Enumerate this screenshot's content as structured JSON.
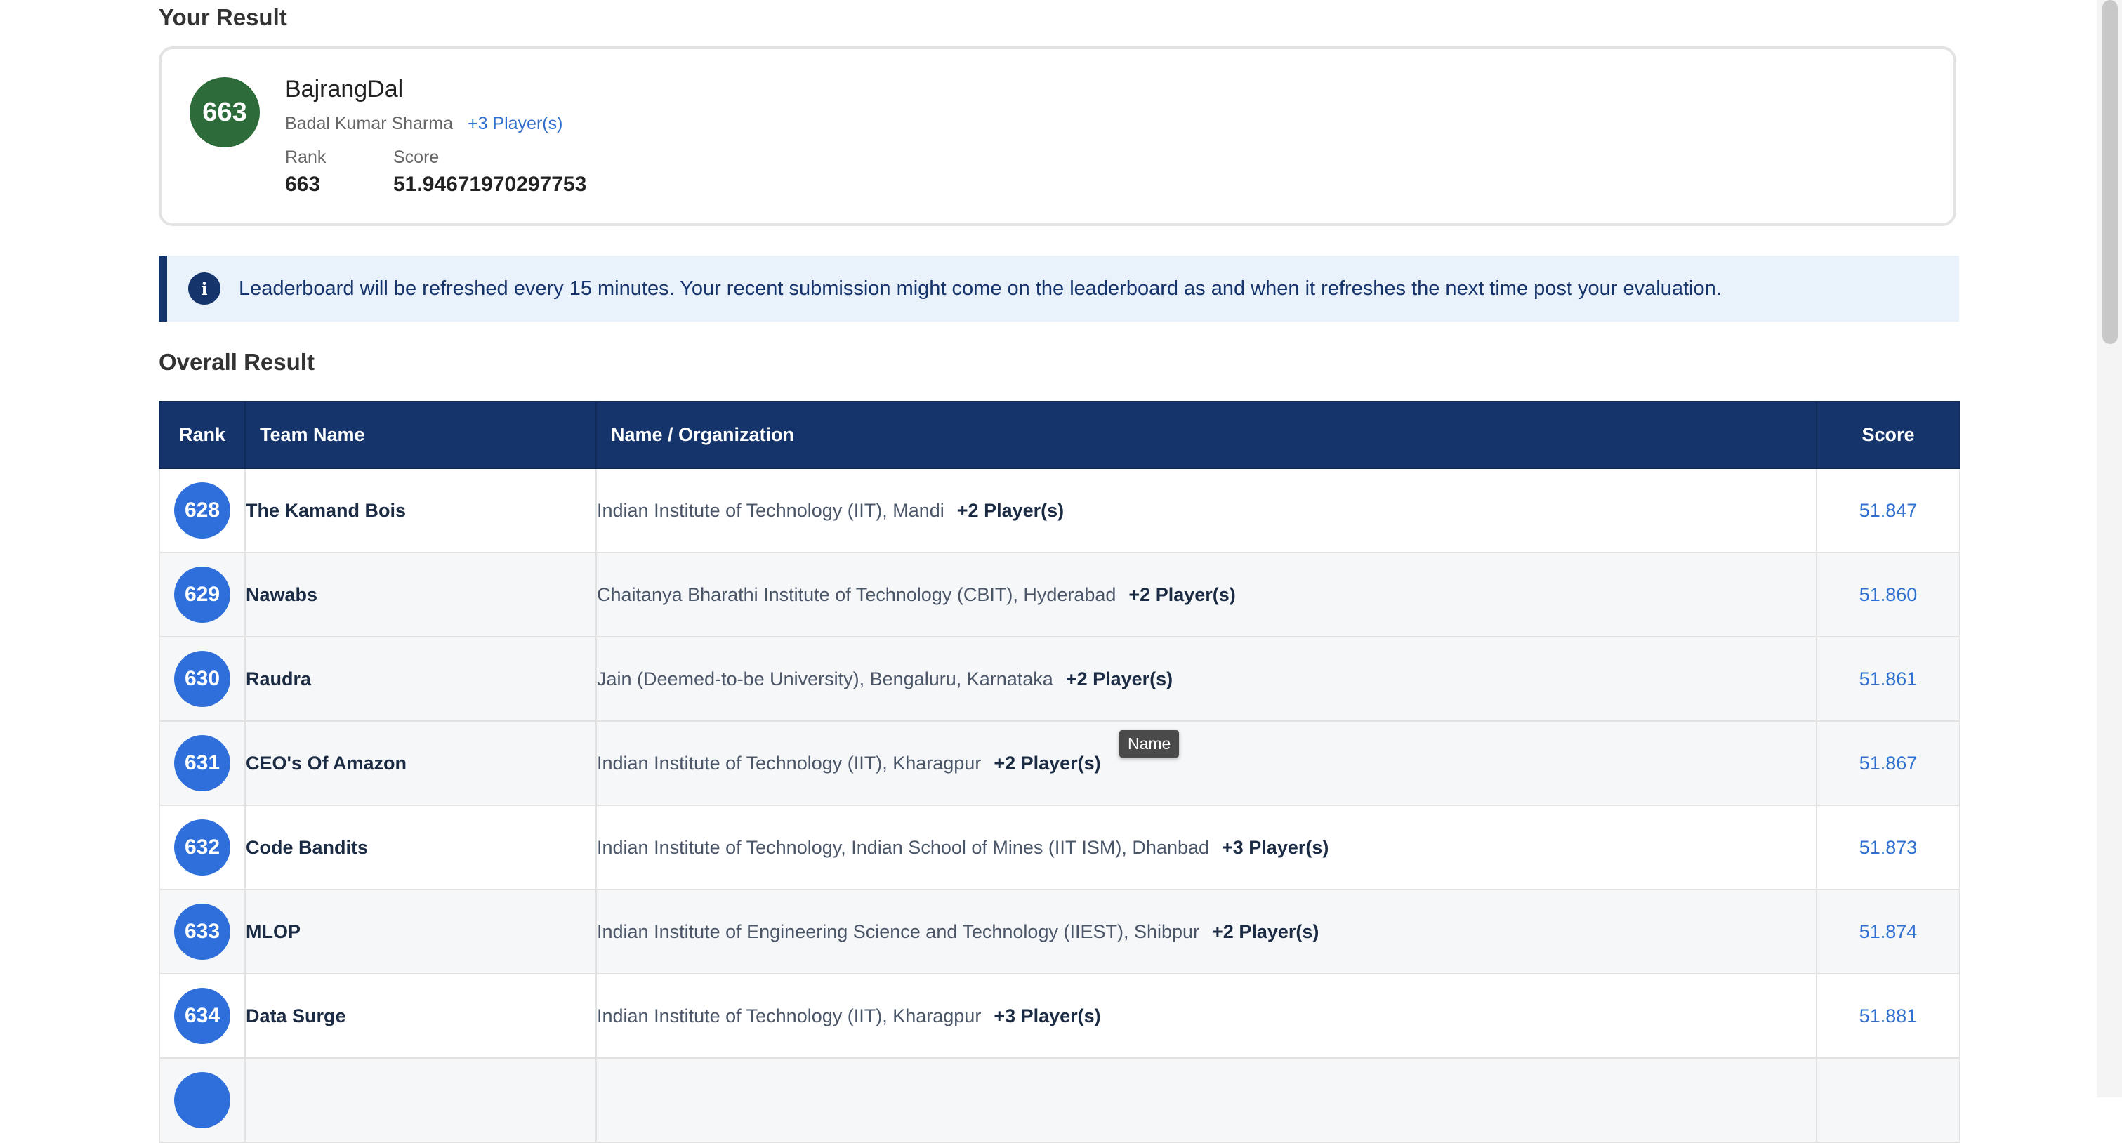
{
  "your_result": {
    "section_title": "Your Result",
    "rank_badge": "663",
    "team_name": "BajrangDal",
    "member": "Badal Kumar Sharma",
    "more_players": "+3 Player(s)",
    "rank_label": "Rank",
    "rank_value": "663",
    "score_label": "Score",
    "score_value": "51.94671970297753"
  },
  "info_banner": {
    "icon": "info-icon",
    "text": "Leaderboard will be refreshed every 15 minutes. Your recent submission might come on the leaderboard as and when it refreshes the next time post your evaluation."
  },
  "overall": {
    "section_title": "Overall Result",
    "columns": [
      "Rank",
      "Team Name",
      "Name / Organization",
      "Score"
    ],
    "rows": [
      {
        "rank": "628",
        "team": "The Kamand Bois",
        "org": "Indian Institute of Technology (IIT), Mandi",
        "players": "+2 Player(s)",
        "score": "51.847"
      },
      {
        "rank": "629",
        "team": "Nawabs",
        "org": "Chaitanya Bharathi Institute of Technology (CBIT), Hyderabad",
        "players": "+2 Player(s)",
        "score": "51.860"
      },
      {
        "rank": "630",
        "team": "Raudra",
        "org": "Jain (Deemed-to-be University), Bengaluru, Karnataka",
        "players": "+2 Player(s)",
        "score": "51.861"
      },
      {
        "rank": "631",
        "team": "CEO's Of Amazon",
        "org": "Indian Institute of Technology (IIT), Kharagpur",
        "players": "+2 Player(s)",
        "score": "51.867"
      },
      {
        "rank": "632",
        "team": "Code Bandits",
        "org": "Indian Institute of Technology, Indian School of Mines (IIT ISM), Dhanbad",
        "players": "+3 Player(s)",
        "score": "51.873"
      },
      {
        "rank": "633",
        "team": "MLOP",
        "org": "Indian Institute of Engineering Science and Technology (IIEST), Shibpur",
        "players": "+2 Player(s)",
        "score": "51.874"
      },
      {
        "rank": "634",
        "team": "Data Surge",
        "org": "Indian Institute of Technology (IIT), Kharagpur",
        "players": "+3 Player(s)",
        "score": "51.881"
      }
    ]
  },
  "tooltip": "Name"
}
